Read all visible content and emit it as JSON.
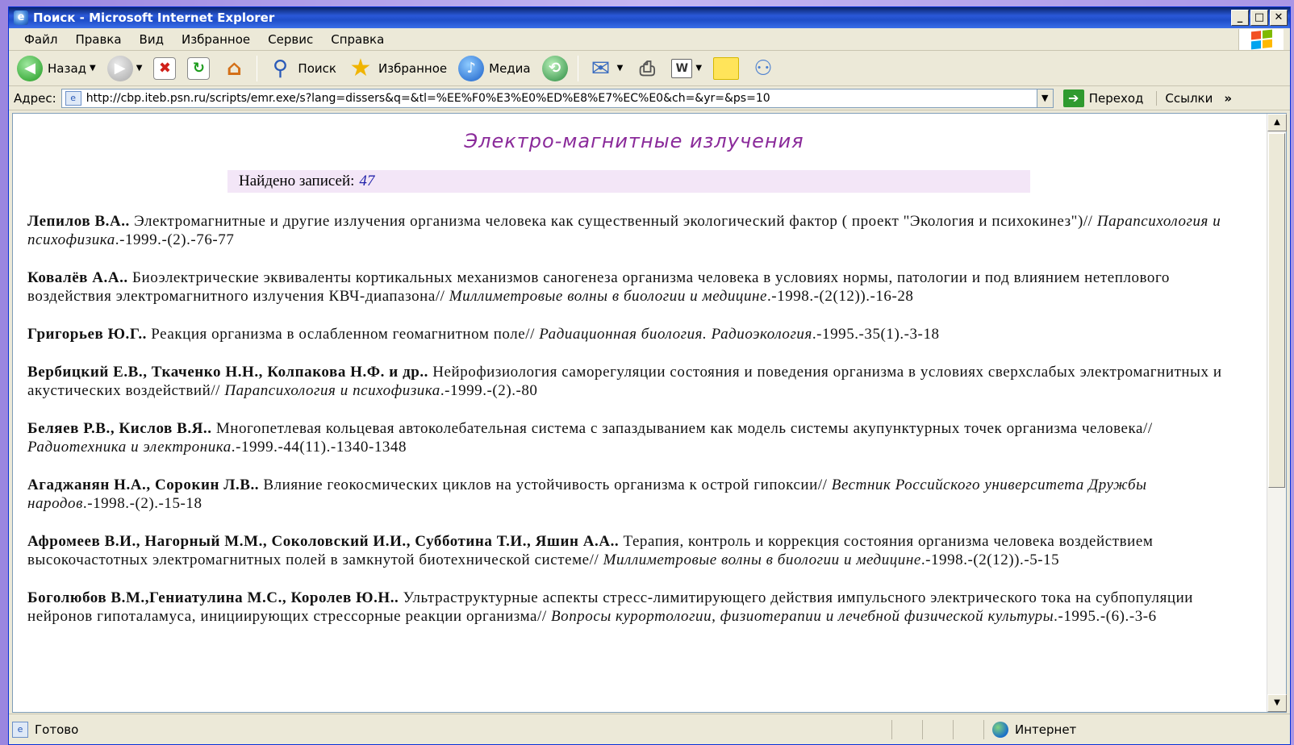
{
  "window": {
    "title": "Поиск - Microsoft Internet Explorer",
    "icon": "ie-icon",
    "controls": [
      "_",
      "□",
      "✕"
    ]
  },
  "menubar": {
    "items": [
      "Файл",
      "Правка",
      "Вид",
      "Избранное",
      "Сервис",
      "Справка"
    ]
  },
  "toolbar": {
    "back_label": "Назад",
    "search_label": "Поиск",
    "favorites_label": "Избранное",
    "media_label": "Медиа"
  },
  "addressbar": {
    "label": "Адрес:",
    "url": "http://cbp.iteb.psn.ru/scripts/emr.exe/s?lang=dissers&q=&tl=%EE%F0%E3%E0%ED%E8%E7%EC%E0&ch=&yr=&ps=10",
    "go_label": "Переход",
    "links_label": "Ссылки"
  },
  "page": {
    "heading": "Электро-магнитные излучения",
    "found_label": "Найдено записей:",
    "found_count": "47",
    "records": [
      {
        "authors": "Лепилов В.А..",
        "text": " Электромагнитные и другие излучения организма человека как существенный экологический фактор ( проект \"Экология и психокинез\")// ",
        "source": "Парапсихология и психофизика",
        "tail": ".-1999.-(2).-76-77"
      },
      {
        "authors": "Ковалёв А.А..",
        "text": " Биоэлектрические эквиваленты кортикальных механизмов саногенеза организма человека в условиях нормы, патологии и под влиянием нетеплового воздействия электромагнитного излучения КВЧ-диапазона// ",
        "source": "Миллиметровые волны в биологии и медицине",
        "tail": ".-1998.-(2(12)).-16-28"
      },
      {
        "authors": "Григорьев Ю.Г..",
        "text": " Реакция организма в ослабленном геомагнитном поле// ",
        "source": "Радиационная биология. Радиоэкология",
        "tail": ".-1995.-35(1).-3-18"
      },
      {
        "authors": "Вербицкий Е.В., Ткаченко Н.Н., Колпакова Н.Ф. и др..",
        "text": " Нейрофизиология саморегуляции состояния и поведения организма в условиях сверхслабых электромагнитных и акустических воздействий// ",
        "source": "Парапсихология и психофизика",
        "tail": ".-1999.-(2).-80"
      },
      {
        "authors": "Беляев Р.В., Кислов В.Я..",
        "text": " Многопетлевая кольцевая автоколебательная система с запаздыванием как модель системы акупунктурных точек организма человека// ",
        "source": "Радиотехника и электроника",
        "tail": ".-1999.-44(11).-1340-1348"
      },
      {
        "authors": "Агаджанян Н.А., Сорокин Л.В..",
        "text": " Влияние геокосмических циклов на устойчивость организма к острой гипоксии// ",
        "source": "Вестник Российского университета Дружбы народов",
        "tail": ".-1998.-(2).-15-18"
      },
      {
        "authors": "Афромеев В.И., Нагорный М.М., Соколовский И.И., Субботина Т.И., Яшин А.А..",
        "text": " Терапия, контроль и коррекция состояния организма человека воздействием высокочастотных электромагнитных полей в замкнутой биотехнической системе// ",
        "source": "Миллиметровые волны в биологии и медицине",
        "tail": ".-1998.-(2(12)).-5-15"
      },
      {
        "authors": "Боголюбов В.М.,Гениатулина М.С., Королев Ю.Н..",
        "text": " Ультраструктурные аспекты стресс-лимитирующего действия импульсного электрического тока на субпопуляции нейронов гипоталамуса, инициирующих стрессорные реакции организма// ",
        "source": "Вопросы курортологии, физиотерапии и лечебной физической культуры",
        "tail": ".-1995.-(6).-3-6"
      }
    ]
  },
  "statusbar": {
    "status": "Готово",
    "zone": "Интернет"
  },
  "colors": {
    "heading": "#8a2a9a",
    "found_bg": "#f3e6f7",
    "count": "#2222aa",
    "titlebar": "#1f4dc8"
  }
}
